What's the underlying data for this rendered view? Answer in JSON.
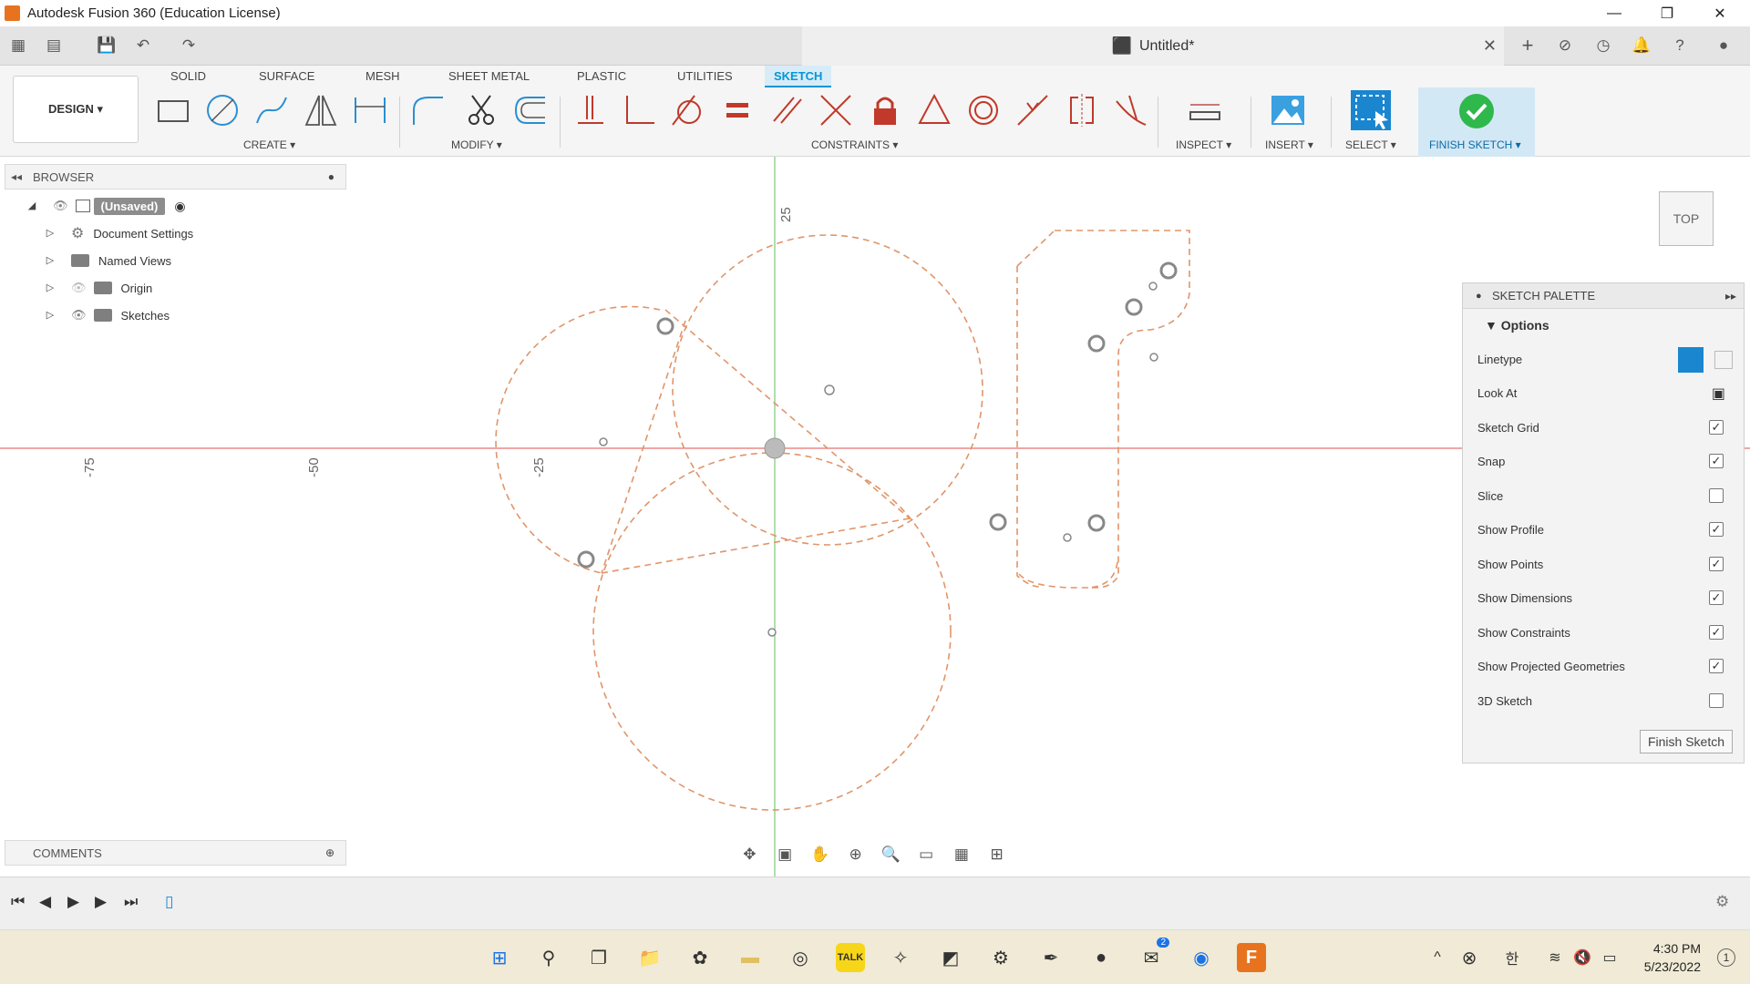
{
  "window": {
    "title": "Autodesk Fusion 360 (Education License)",
    "controls": {
      "minimize": "—",
      "restore": "❐",
      "close": "✕"
    }
  },
  "document": {
    "name": "Untitled*"
  },
  "ribbon": {
    "workspace": "DESIGN ▾",
    "tabs": [
      "SOLID",
      "SURFACE",
      "MESH",
      "SHEET METAL",
      "PLASTIC",
      "UTILITIES",
      "SKETCH"
    ],
    "active_tab": "SKETCH",
    "groups": {
      "create": "CREATE ▾",
      "modify": "MODIFY ▾",
      "constraints": "CONSTRAINTS ▾",
      "inspect": "INSPECT ▾",
      "insert": "INSERT ▾",
      "select": "SELECT ▾",
      "finish": "FINISH SKETCH ▾"
    }
  },
  "browser": {
    "header": "BROWSER",
    "root": "(Unsaved)",
    "items": [
      {
        "label": "Document Settings",
        "icon": "gear-icon"
      },
      {
        "label": "Named Views",
        "icon": "folder-icon"
      },
      {
        "label": "Origin",
        "icon": "folder-icon"
      },
      {
        "label": "Sketches",
        "icon": "folder-icon"
      }
    ]
  },
  "comments": {
    "header": "COMMENTS"
  },
  "canvas": {
    "axis_labels": {
      "x_neg75": "-75",
      "x_neg50": "-50",
      "x_neg25": "-25",
      "y_25": "25"
    },
    "viewcube": "TOP"
  },
  "palette": {
    "header": "SKETCH PALETTE",
    "section": "Options",
    "options": [
      {
        "label": "Linetype",
        "type": "linetype"
      },
      {
        "label": "Look At",
        "type": "button"
      },
      {
        "label": "Sketch Grid",
        "checked": true
      },
      {
        "label": "Snap",
        "checked": true
      },
      {
        "label": "Slice",
        "checked": false
      },
      {
        "label": "Show Profile",
        "checked": true
      },
      {
        "label": "Show Points",
        "checked": true
      },
      {
        "label": "Show Dimensions",
        "checked": true
      },
      {
        "label": "Show Constraints",
        "checked": true
      },
      {
        "label": "Show Projected Geometries",
        "checked": true
      },
      {
        "label": "3D Sketch",
        "checked": false
      }
    ],
    "finish_button": "Finish Sketch"
  },
  "taskbar": {
    "time": "4:30 PM",
    "date": "5/23/2022",
    "notification_count": "1",
    "mail_badge": "2"
  },
  "colors": {
    "accent": "#0696d7",
    "sketch_line": "#e0956a",
    "x_axis": "#e87070",
    "y_axis": "#7ac77a",
    "finish_check": "#2fb84b"
  }
}
